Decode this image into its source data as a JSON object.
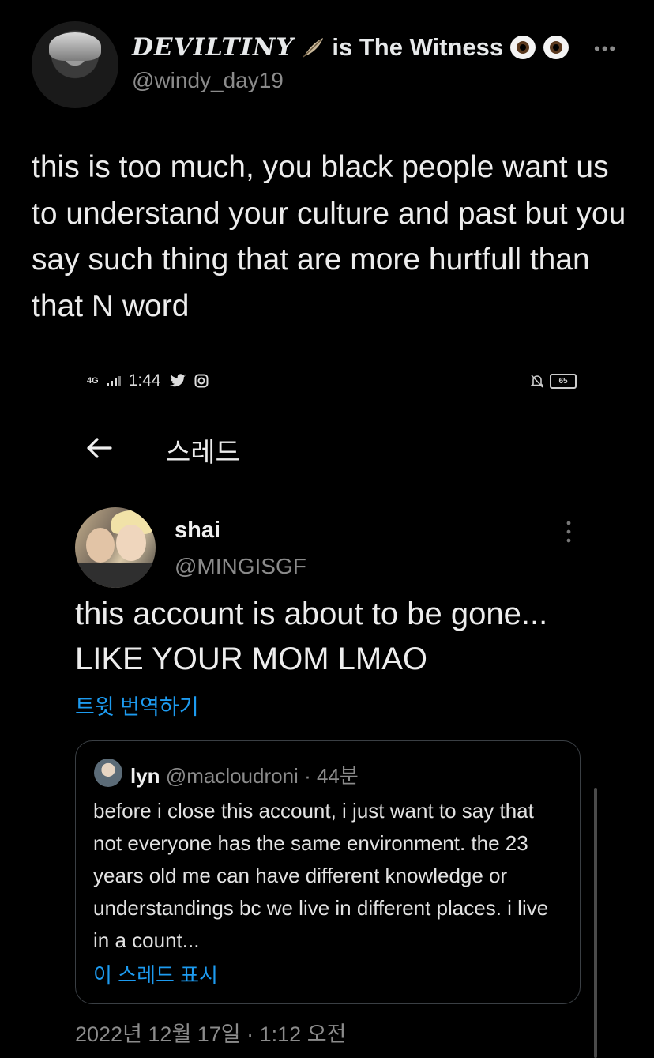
{
  "outer_tweet": {
    "display_name_fancy": "DEVILTINY",
    "display_name_rest": "is The Witness",
    "handle": "@windy_day19",
    "more_icon": "more-horizontal-icon",
    "text": "this is too much, you black people want us to understand your culture and past but you say such thing that are more hurtfull than that N word"
  },
  "screenshot": {
    "status_bar": {
      "network": "4G",
      "time": "1:44",
      "battery": "65"
    },
    "header": {
      "back_icon": "arrow-left-icon",
      "title": "스레드"
    },
    "tweet": {
      "name": "shai",
      "handle": "@MINGISGF",
      "text": "this account is about to be gone... LIKE YOUR MOM LMAO",
      "translate_label": "트윗 번역하기",
      "quote": {
        "name": "lyn",
        "handle": "@macloudroni",
        "time": "· 44분",
        "text": "before i close this account, i just want to say that not everyone has the same environment. the 23 years old me can have different knowledge or understandings bc we live in different places. i live in a count...",
        "show_thread": "이 스레드 표시"
      },
      "timestamp": "2022년 12월 17일 · 1:12 오전"
    }
  }
}
